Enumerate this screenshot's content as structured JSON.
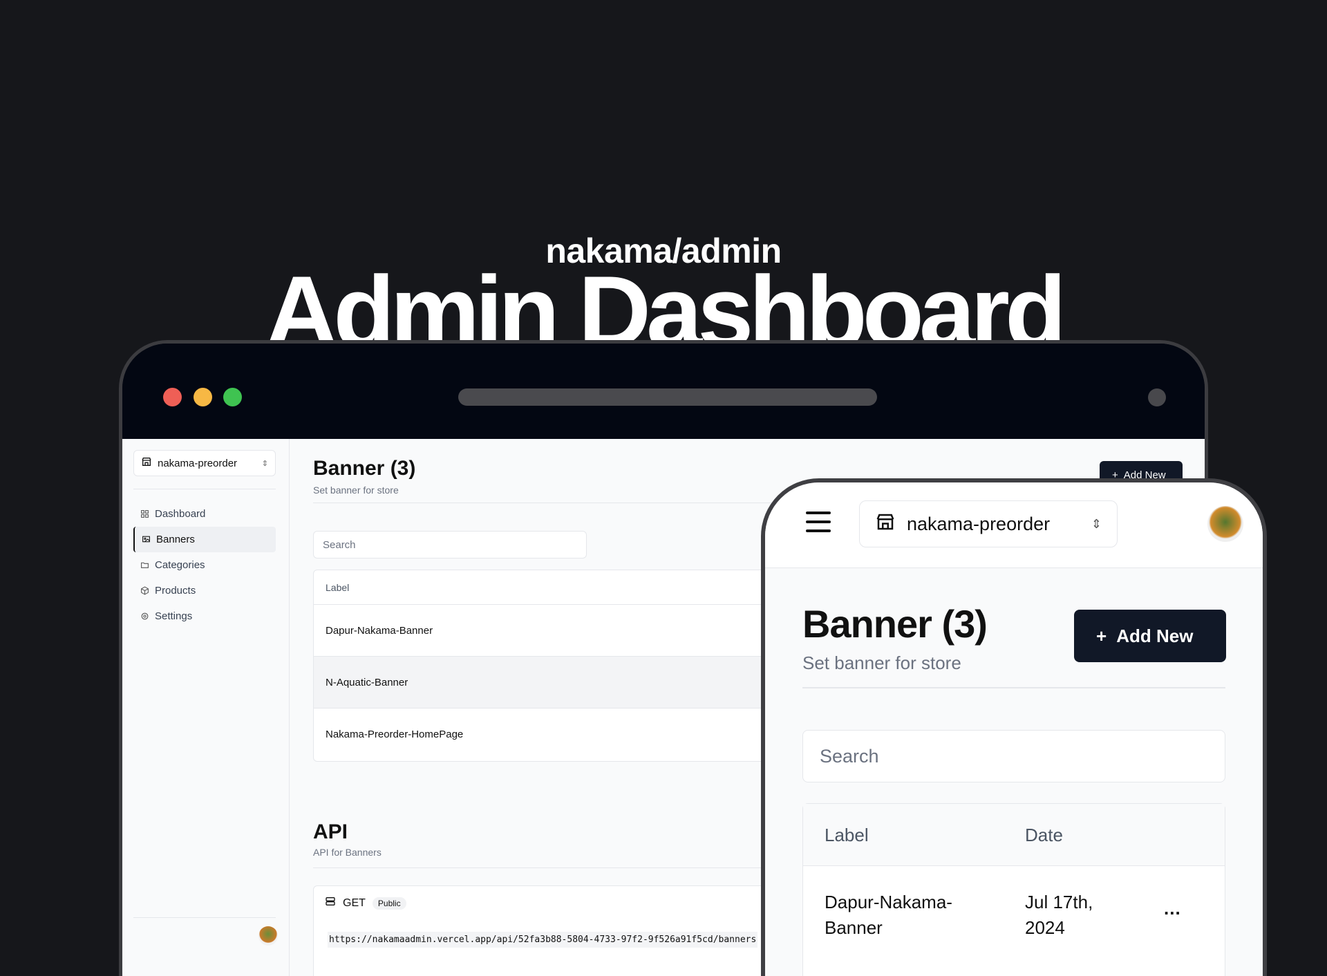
{
  "hero": {
    "subtitle": "nakama/admin",
    "title": "Admin Dashboard"
  },
  "desktop": {
    "store_selector": "nakama-preorder",
    "nav": [
      {
        "label": "Dashboard",
        "icon": "grid-icon",
        "active": false
      },
      {
        "label": "Banners",
        "icon": "image-icon",
        "active": true
      },
      {
        "label": "Categories",
        "icon": "folder-icon",
        "active": false
      },
      {
        "label": "Products",
        "icon": "package-icon",
        "active": false
      },
      {
        "label": "Settings",
        "icon": "gear-icon",
        "active": false
      }
    ],
    "heading": "Banner (3)",
    "subheading": "Set banner for store",
    "add_button": "Add New",
    "search_placeholder": "Search",
    "table": {
      "headers": [
        "Label"
      ],
      "rows": [
        "Dapur-Nakama-Banner",
        "N-Aquatic-Banner",
        "Nakama-Preorder-HomePage"
      ]
    },
    "api": {
      "heading": "API",
      "subheading": "API for Banners",
      "method": "GET",
      "badge": "Public",
      "url": "https://nakamaadmin.vercel.app/api/52fa3b88-5804-4733-97f2-9f526a91f5cd/banners"
    }
  },
  "mobile": {
    "store_selector": "nakama-preorder",
    "heading": "Banner (3)",
    "subheading": "Set banner for store",
    "add_button": "Add New",
    "search_placeholder": "Search",
    "table": {
      "headers": [
        "Label",
        "Date"
      ],
      "rows": [
        {
          "label": "Dapur-Nakama-Banner",
          "date": "Jul 17th, 2024",
          "action": "..."
        }
      ]
    }
  },
  "colors": {
    "background": "#16171b",
    "primary": "#111827",
    "traffic_red": "#ef5f56",
    "traffic_yellow": "#f7b844",
    "traffic_green": "#3fc351"
  }
}
